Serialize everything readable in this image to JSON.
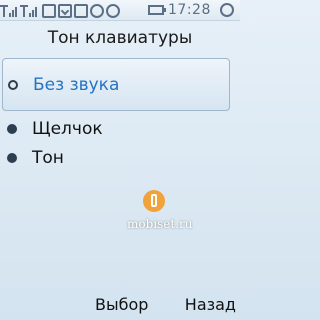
{
  "status_bar": {
    "time": "17:28",
    "icons": [
      "signal-icon",
      "signal-icon",
      "gprs-icon",
      "message-icon",
      "mail-icon",
      "headset-icon",
      "mms-icon",
      "battery-icon",
      "alarm-icon"
    ]
  },
  "screen": {
    "title": "Тон клавиатуры",
    "options": [
      {
        "label": "Без звука",
        "selected": true
      },
      {
        "label": "Щелчок",
        "selected": false
      },
      {
        "label": "Тон",
        "selected": false
      }
    ]
  },
  "watermark": {
    "text": "mobiset.ru"
  },
  "softkeys": {
    "left": "Выбор",
    "right": "Назад"
  }
}
